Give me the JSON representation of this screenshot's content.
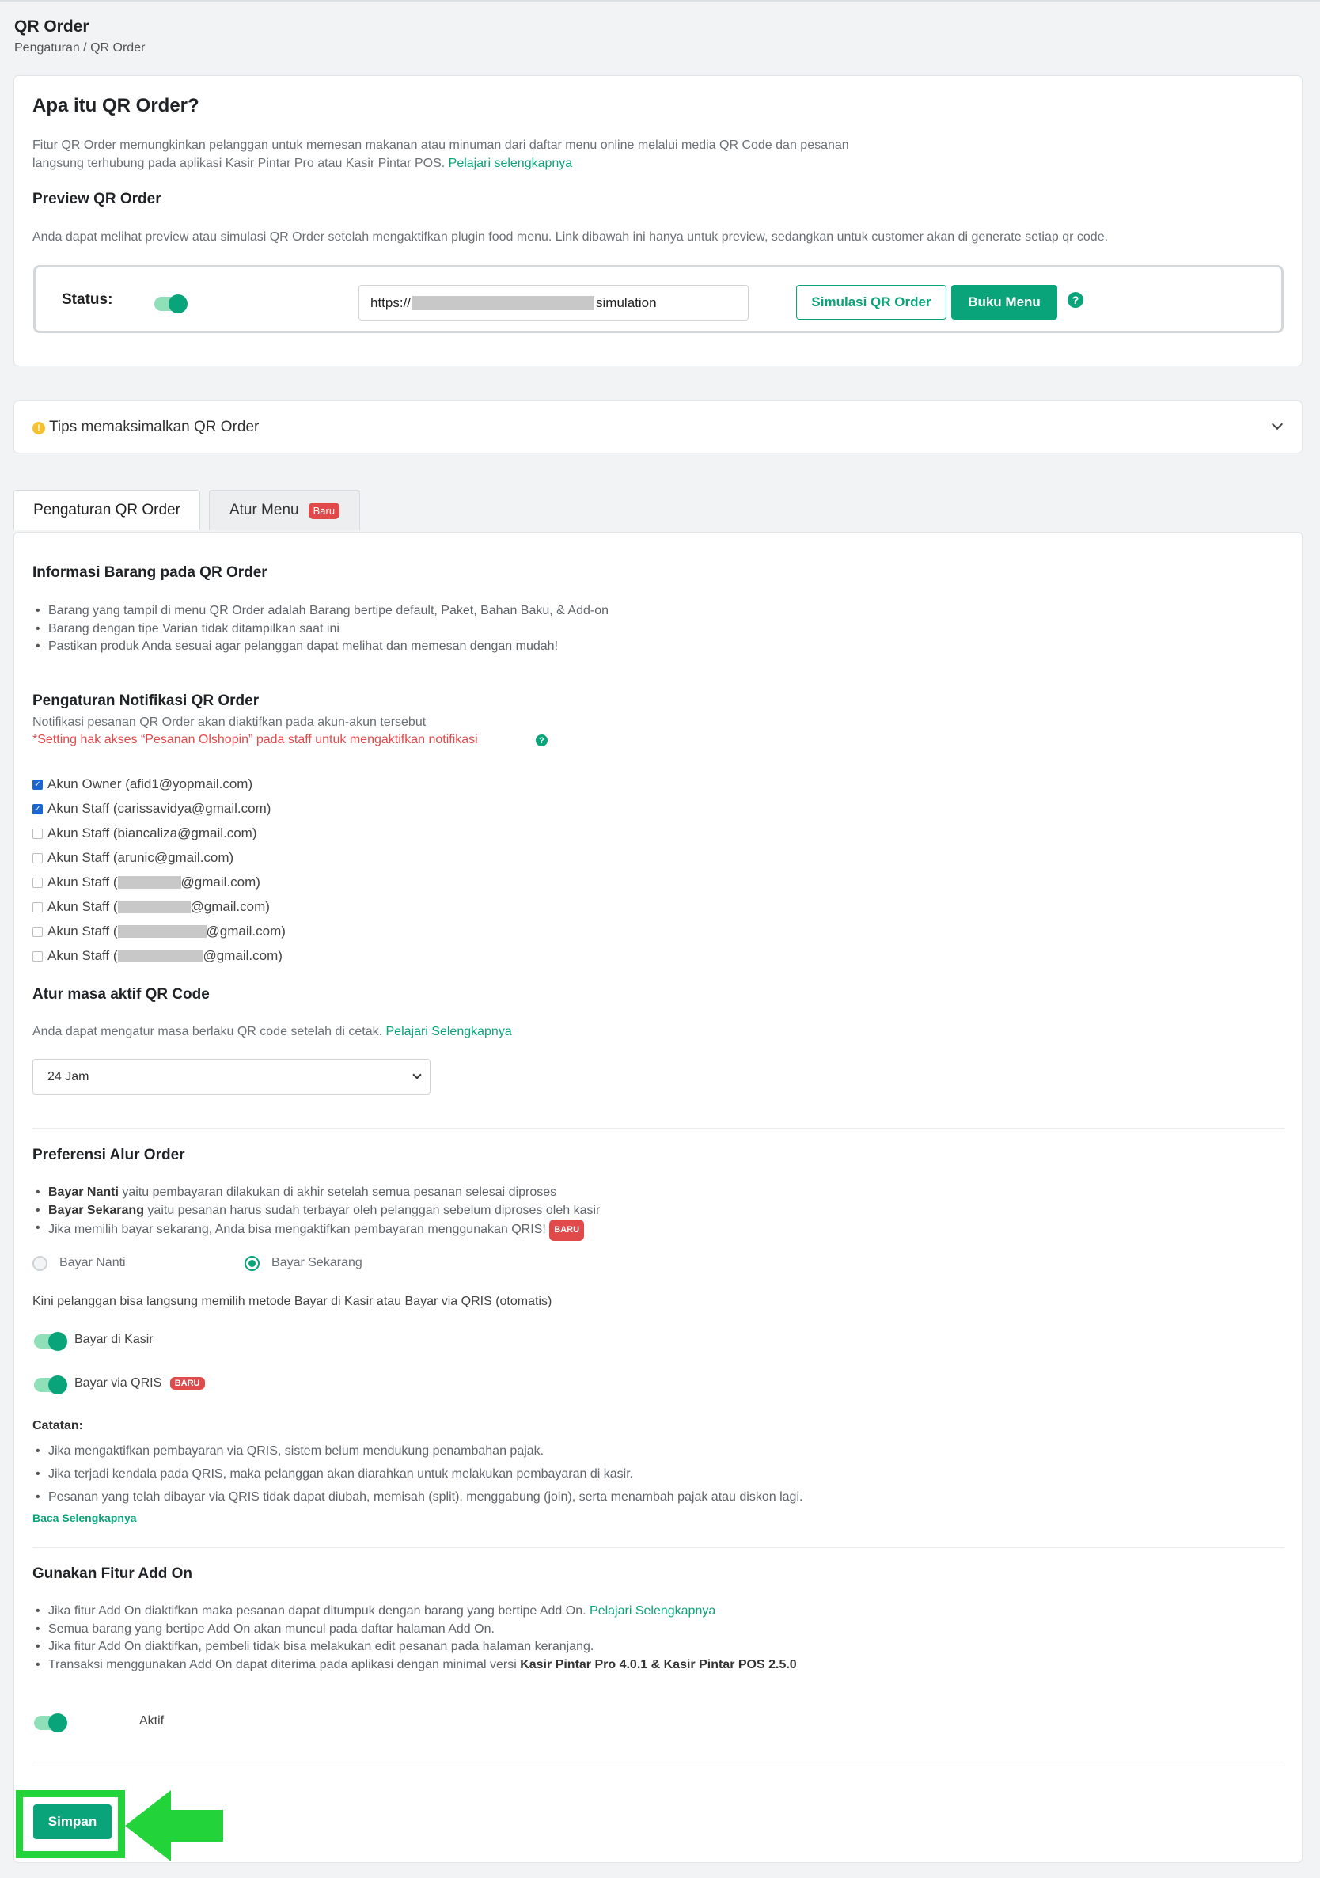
{
  "page": {
    "title": "QR Order",
    "breadcrumb": "Pengaturan / QR Order"
  },
  "intro": {
    "title": "Apa itu QR Order?",
    "desc_line1": "Fitur QR Order memungkinkan pelanggan untuk memesan makanan atau minuman dari daftar menu online melalui media QR Code dan pesanan",
    "desc_line2": "langsung terhubung pada aplikasi Kasir Pintar Pro atau Kasir Pintar POS.",
    "learn_more": "Pelajari selengkapnya",
    "preview_title": "Preview QR Order",
    "preview_desc": "Anda dapat melihat preview atau simulasi QR Order setelah mengaktifkan plugin food menu. Link dibawah ini hanya untuk preview, sedangkan untuk customer akan di generate setiap qr code."
  },
  "status": {
    "label": "Status:",
    "toggle_on": true,
    "url_prefix": "https://",
    "url_suffix": "simulation",
    "btn_simulasi": "Simulasi QR Order",
    "btn_buku_menu": "Buku Menu",
    "help": "?"
  },
  "tips": {
    "label": "Tips memaksimalkan QR Order",
    "icon": "!"
  },
  "tabs": {
    "pengaturan": "Pengaturan QR Order",
    "atur_menu": "Atur Menu",
    "atur_menu_badge": "Baru"
  },
  "info_barang": {
    "title": "Informasi Barang pada QR Order",
    "items": [
      "Barang yang tampil di menu QR Order adalah Barang bertipe default, Paket, Bahan Baku, & Add-on",
      "Barang dengan tipe Varian tidak ditampilkan saat ini",
      "Pastikan produk Anda sesuai agar pelanggan dapat melihat dan memesan dengan mudah!"
    ]
  },
  "notifikasi": {
    "title": "Pengaturan Notifikasi QR Order",
    "desc": "Notifikasi pesanan QR Order akan diaktifkan pada akun-akun tersebut",
    "note": "*Setting hak akses “Pesanan Olshopin” pada staff untuk mengaktifkan notifikasi",
    "help": "?",
    "accounts": [
      {
        "prefix": "Akun Owner (afid1@yopmail.com)",
        "suffix": "",
        "checked": true
      },
      {
        "prefix": "Akun Staff (carissavidya@gmail.com)",
        "suffix": "",
        "checked": true
      },
      {
        "prefix": "Akun Staff (biancaliza@gmail.com)",
        "suffix": "",
        "checked": false
      },
      {
        "prefix": "Akun Staff (arunic@gmail.com)",
        "suffix": "",
        "checked": false
      },
      {
        "prefix": "Akun Staff (",
        "suffix": "@gmail.com)",
        "checked": false
      },
      {
        "prefix": "Akun Staff (",
        "suffix": "@gmail.com)",
        "checked": false
      },
      {
        "prefix": "Akun Staff (",
        "suffix": "@gmail.com)",
        "checked": false
      },
      {
        "prefix": "Akun Staff (",
        "suffix": "@gmail.com)",
        "checked": false
      }
    ]
  },
  "masa_aktif": {
    "title": "Atur masa aktif QR Code",
    "desc": "Anda dapat mengatur masa berlaku QR code setelah di cetak.",
    "link": "Pelajari Selengkapnya",
    "selected": "24 Jam"
  },
  "alur_order": {
    "title": "Preferensi Alur Order",
    "item1_bold": "Bayar Nanti",
    "item1_rest": " yaitu pembayaran dilakukan di akhir setelah semua pesanan selesai diproses",
    "item2_bold": "Bayar Sekarang",
    "item2_rest": " yaitu pesanan harus sudah terbayar oleh pelanggan sebelum diproses oleh kasir",
    "item3": "Jika memilih bayar sekarang, Anda bisa mengaktifkan pembayaran menggunakan QRIS!",
    "badge": "BARU",
    "radio_nanti": "Bayar Nanti",
    "radio_sekarang": "Bayar Sekarang",
    "selected": "Bayar Sekarang",
    "metode_desc": "Kini pelanggan bisa langsung memilih metode Bayar di Kasir atau Bayar via QRIS (otomatis)",
    "toggle_kasir": "Bayar di Kasir",
    "toggle_qris": "Bayar via QRIS",
    "qris_badge": "BARU",
    "catatan_title": "Catatan:",
    "catatan": [
      "Jika mengaktifkan pembayaran via QRIS, sistem belum mendukung penambahan pajak.",
      "Jika terjadi kendala pada QRIS, maka pelanggan akan diarahkan untuk melakukan pembayaran di kasir.",
      "Pesanan yang telah dibayar via QRIS tidak dapat diubah, memisah (split), menggabung (join), serta menambah pajak atau diskon lagi."
    ],
    "baca": "Baca Selengkapnya"
  },
  "addon": {
    "title": "Gunakan Fitur Add On",
    "item1": "Jika fitur Add On diaktifkan maka pesanan dapat ditumpuk dengan barang yang bertipe Add On.",
    "item1_link": "Pelajari Selengkapnya",
    "item2": "Semua barang yang bertipe Add On akan muncul pada daftar halaman Add On.",
    "item3": "Jika fitur Add On diaktifkan, pembeli tidak bisa melakukan edit pesanan pada halaman keranjang.",
    "item4": "Transaksi menggunakan Add On dapat diterima pada aplikasi dengan minimal versi",
    "item4_bold": "Kasir Pintar Pro 4.0.1 & Kasir Pintar POS 2.5.0",
    "toggle_label": "Aktif"
  },
  "save": {
    "label": "Simpan"
  },
  "colors": {
    "accent": "#0aa47a",
    "danger": "#e04a4a",
    "highlight": "#22d33a"
  }
}
